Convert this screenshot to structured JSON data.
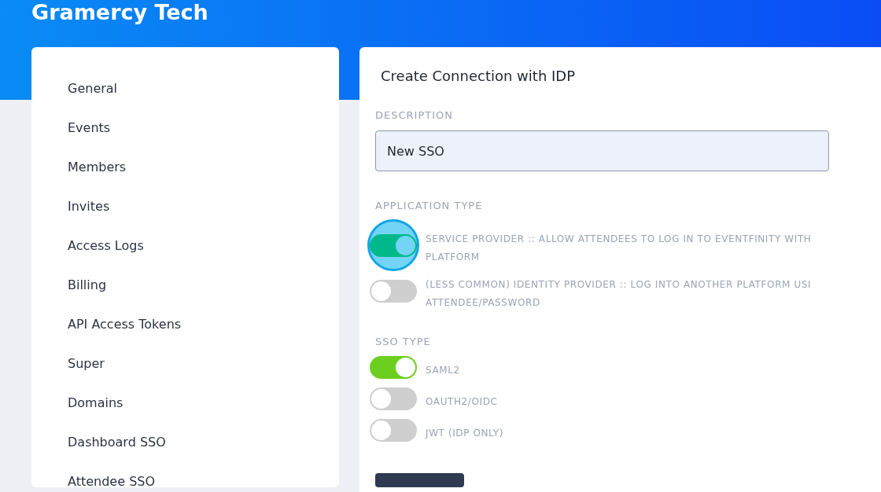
{
  "header": {
    "title": "Gramercy Tech"
  },
  "sidebar": {
    "items": [
      {
        "label": "General"
      },
      {
        "label": "Events"
      },
      {
        "label": "Members"
      },
      {
        "label": "Invites"
      },
      {
        "label": "Access Logs"
      },
      {
        "label": "Billing"
      },
      {
        "label": "API Access Tokens"
      },
      {
        "label": "Super"
      },
      {
        "label": "Domains"
      },
      {
        "label": "Dashboard SSO"
      },
      {
        "label": "Attendee SSO"
      }
    ]
  },
  "form": {
    "title": "Create Connection with IDP",
    "description": {
      "label": "DESCRIPTION",
      "value": "New SSO",
      "focused": true
    },
    "application_type": {
      "label": "APPLICATION TYPE",
      "options": [
        {
          "lines": [
            "SERVICE PROVIDER :: ALLOW ATTENDEES TO LOG IN TO EVENTFINITY WITH",
            "PLATFORM"
          ],
          "on": true,
          "focused": true
        },
        {
          "lines": [
            "(LESS COMMON) IDENTITY PROVIDER :: LOG INTO ANOTHER PLATFORM USI",
            "ATTENDEE/PASSWORD"
          ],
          "on": false,
          "focused": false
        }
      ]
    },
    "sso_type": {
      "label": "SSO TYPE",
      "options": [
        {
          "lines": [
            "SAML2"
          ],
          "on": true,
          "focused": false
        },
        {
          "lines": [
            "OAUTH2/OIDC"
          ],
          "on": false,
          "focused": false
        },
        {
          "lines": [
            "JWT (IDP ONLY)"
          ],
          "on": false,
          "focused": false
        }
      ]
    }
  }
}
